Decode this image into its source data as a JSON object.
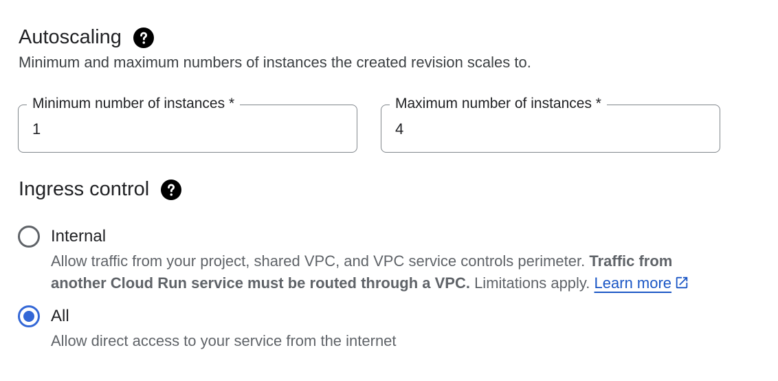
{
  "autoscaling": {
    "title": "Autoscaling",
    "description": "Minimum and maximum numbers of instances the created revision scales to.",
    "min_field": {
      "label": "Minimum number of instances *",
      "value": "1"
    },
    "max_field": {
      "label": "Maximum number of instances *",
      "value": "4"
    }
  },
  "ingress": {
    "title": "Ingress control",
    "options": [
      {
        "label": "Internal",
        "selected": false,
        "description_plain": "Allow traffic from your project, shared VPC, and VPC service controls perimeter. ",
        "description_bold_1": "Traffic from",
        "description_bold_2": "another Cloud Run service must be routed through a VPC.",
        "description_tail": " Limitations apply. ",
        "link_text": "Learn more"
      },
      {
        "label": "All",
        "selected": true,
        "description": "Allow direct access to your service from the internet"
      }
    ]
  },
  "colors": {
    "accent": "#3367d6",
    "link": "#1a56c5",
    "border": "#80868b"
  },
  "icons": {
    "help": "help-circle-icon",
    "external_link": "open-in-new-icon"
  }
}
